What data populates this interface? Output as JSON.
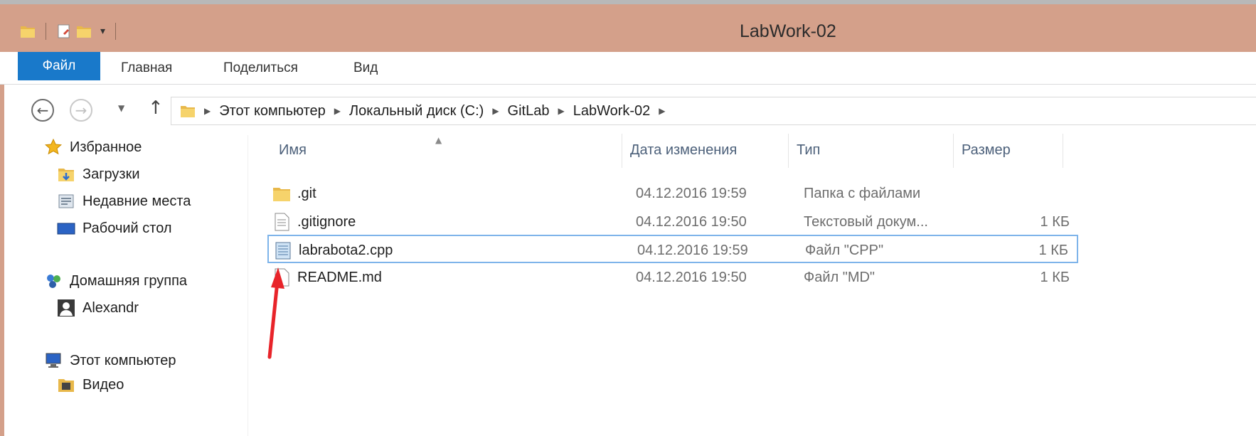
{
  "window": {
    "title": "LabWork-02"
  },
  "ribbon": {
    "tabs": [
      "Файл",
      "Главная",
      "Поделиться",
      "Вид"
    ]
  },
  "address": {
    "crumbs": [
      "Этот компьютер",
      "Локальный диск (C:)",
      "GitLab",
      "LabWork-02"
    ]
  },
  "nav": {
    "favorites": "Избранное",
    "downloads": "Загрузки",
    "recent": "Недавние места",
    "desktop": "Рабочий стол",
    "homegroup": "Домашняя группа",
    "user": "Alexandr",
    "computer": "Этот компьютер",
    "video": "Видео"
  },
  "columns": {
    "name": "Имя",
    "date": "Дата изменения",
    "type": "Тип",
    "size": "Размер"
  },
  "files": [
    {
      "name": ".git",
      "date": "04.12.2016 19:59",
      "type": "Папка с файлами",
      "size": ""
    },
    {
      "name": ".gitignore",
      "date": "04.12.2016 19:50",
      "type": "Текстовый докум...",
      "size": "1 КБ"
    },
    {
      "name": "labrabota2.cpp",
      "date": "04.12.2016 19:59",
      "type": "Файл \"CPP\"",
      "size": "1 КБ"
    },
    {
      "name": "README.md",
      "date": "04.12.2016 19:50",
      "type": "Файл \"MD\"",
      "size": "1 КБ"
    }
  ],
  "colors": {
    "titlebar": "#d4a08a",
    "file_tab": "#1979ca",
    "selection": "#7eb4ea",
    "annotation_arrow": "#e8242a"
  }
}
